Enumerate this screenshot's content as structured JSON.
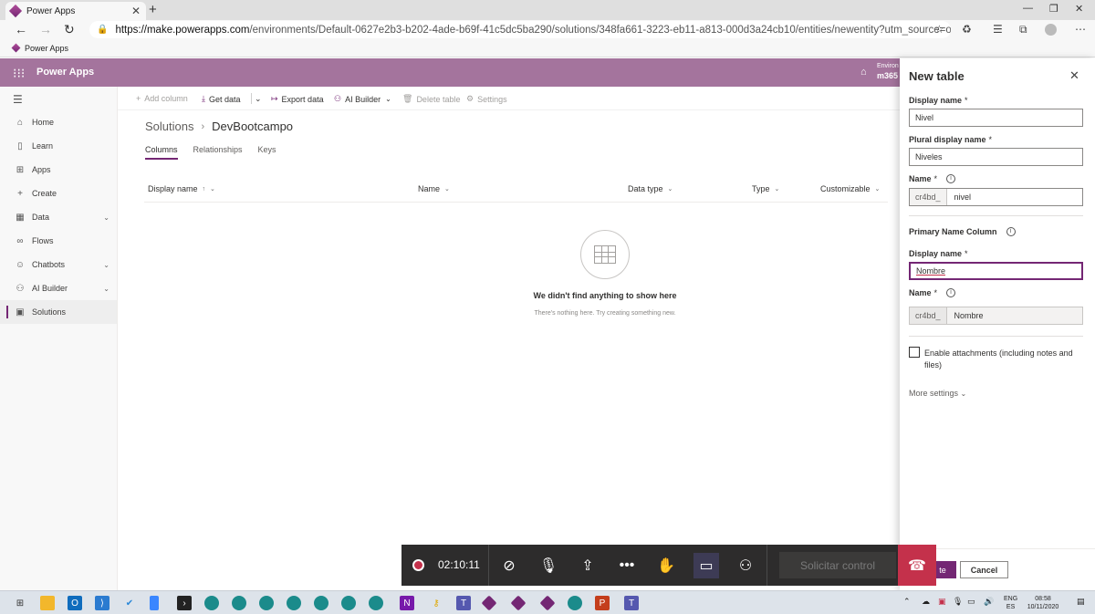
{
  "browser": {
    "tab_title": "Power Apps",
    "url_host": "https://make.powerapps.com",
    "url_path": "/environments/Default-0627e2b3-b202-4ade-b69f-41c5dc5ba290/solutions/348fa661-3223-eb11-a813-000d3a24cb10/entities/newentity?utm_source=office&utm_medium...",
    "favorite_label": "Power Apps"
  },
  "app": {
    "brand": "Power Apps",
    "env_line1": "Environ",
    "env_line2": "m365"
  },
  "nav": {
    "items": [
      {
        "label": "Home",
        "icon": "home-icon"
      },
      {
        "label": "Learn",
        "icon": "book-icon"
      },
      {
        "label": "Apps",
        "icon": "apps-icon"
      },
      {
        "label": "Create",
        "icon": "plus-icon"
      },
      {
        "label": "Data",
        "icon": "table-icon"
      },
      {
        "label": "Flows",
        "icon": "flow-icon"
      },
      {
        "label": "Chatbots",
        "icon": "chatbot-icon"
      },
      {
        "label": "AI Builder",
        "icon": "ai-builder-icon"
      },
      {
        "label": "Solutions",
        "icon": "solutions-icon"
      }
    ]
  },
  "command_bar": {
    "add_column": "Add column",
    "get_data": "Get data",
    "export_data": "Export data",
    "ai_builder": "AI Builder",
    "delete_table": "Delete table",
    "settings": "Settings"
  },
  "breadcrumb": {
    "parent": "Solutions",
    "current": "DevBootcampo"
  },
  "tabs": [
    "Columns",
    "Relationships",
    "Keys"
  ],
  "columns": [
    "Display name",
    "Name",
    "Data type",
    "Type",
    "Customizable"
  ],
  "empty_state": {
    "title": "We didn't find anything to show here",
    "subtitle": "There's nothing here. Try creating something new."
  },
  "panel": {
    "title": "New table",
    "display_name_label": "Display name",
    "display_name_value": "Nivel",
    "plural_label": "Plural display name",
    "plural_value": "Niveles",
    "name_label": "Name",
    "name_prefix": "cr4bd_",
    "name_value": "nivel",
    "primary_column_label": "Primary Name Column",
    "primary_display_label": "Display name",
    "primary_display_value": "Nombre",
    "primary_name_label": "Name",
    "primary_name_prefix": "cr4bd_",
    "primary_name_value": "Nombre",
    "attachments_label": "Enable attachments (including notes and files)",
    "more_settings": "More settings",
    "create_label": "te",
    "cancel_label": "Cancel",
    "required_mark": "*"
  },
  "call": {
    "timer": "02:10:11",
    "request_control": "Solicitar control"
  },
  "taskbar": {
    "lang1": "ENG",
    "lang2": "ES",
    "time": "08:58",
    "date": "10/11/2020"
  },
  "colors": {
    "brand_purple": "#742774",
    "header_bg": "#a4749d",
    "hangup_red": "#c4314b"
  }
}
